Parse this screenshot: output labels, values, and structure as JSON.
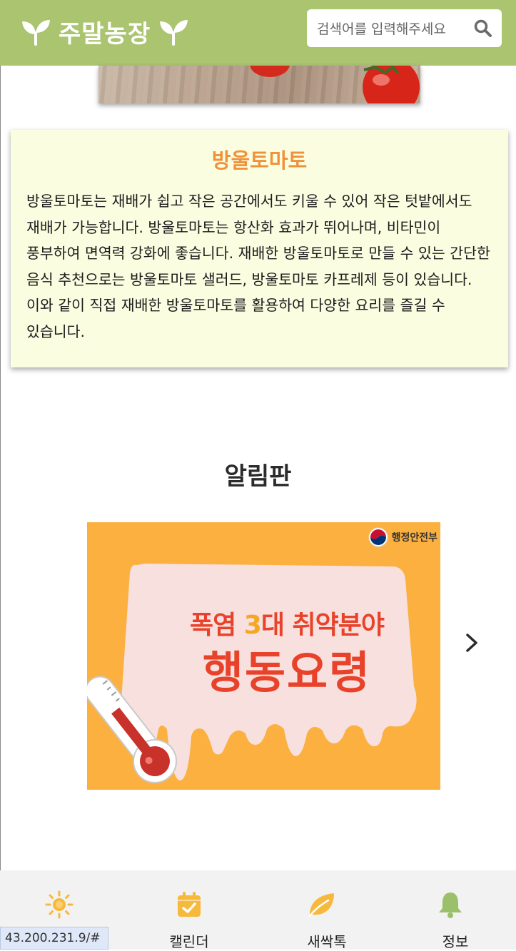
{
  "header": {
    "logo_text": "주말농장",
    "search": {
      "placeholder": "검색어를 입력해주세요"
    },
    "bg_color": "#abc470"
  },
  "hero": {
    "image": "tomato-on-wood-photo"
  },
  "card": {
    "title": "방울토마토",
    "body": "방울토마토는 재배가 쉽고 작은 공간에서도 키울 수 있어 작은 텃밭에서도 재배가 가능합니다. 방울토마토는 항산화 효과가 뛰어나며, 비타민이 풍부하여 면역력 강화에 좋습니다. 재배한 방울토마토로 만들 수 있는 간단한 음식 추천으로는 방울토마토 샐러드, 방울토마토 카프레제 등이 있습니다. 이와 같이 직접 재배한 방울토마토를 활용하여 다양한 요리를 즐길 수 있습니다.",
    "bg_color": "#fafde0",
    "title_color": "#f0923a"
  },
  "notice": {
    "title": "알림판",
    "banner": {
      "ministry": "행정안전부",
      "line1_a": "폭염 ",
      "line1_num": "3",
      "line1_b": "대 취약분야",
      "line2": "행동요령",
      "bg_color": "#fbb040"
    }
  },
  "bottom_nav": {
    "items": [
      {
        "icon": "sun-icon",
        "label": ""
      },
      {
        "icon": "calendar-check-icon",
        "label": "캘린더"
      },
      {
        "icon": "leaf-icon",
        "label": "새싹톡"
      },
      {
        "icon": "bell-icon",
        "label": "정보"
      }
    ]
  },
  "status_bar": {
    "url": "43.200.231.9/#"
  }
}
